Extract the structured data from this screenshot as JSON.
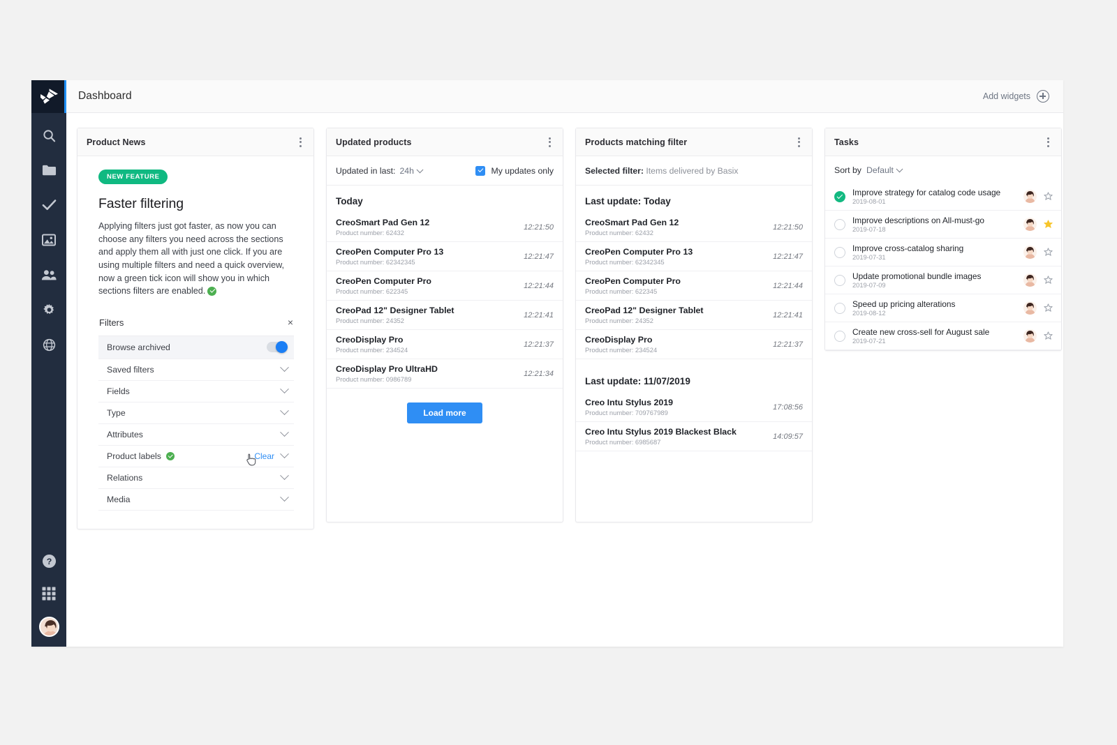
{
  "topbar": {
    "title": "Dashboard",
    "add_widgets_label": "Add widgets"
  },
  "sidebar": {
    "items": [
      {
        "icon": "search-icon",
        "name": "search"
      },
      {
        "icon": "folder-icon",
        "name": "catalog"
      },
      {
        "icon": "check-icon",
        "name": "tasks"
      },
      {
        "icon": "image-icon",
        "name": "media"
      },
      {
        "icon": "users-icon",
        "name": "users"
      },
      {
        "icon": "gear-icon",
        "name": "settings"
      },
      {
        "icon": "globe-icon",
        "name": "globe"
      }
    ],
    "bottom_items": [
      {
        "icon": "help-icon",
        "name": "help"
      },
      {
        "icon": "apps-grid-icon",
        "name": "apps"
      },
      {
        "icon": "avatar",
        "name": "profile"
      }
    ]
  },
  "product_news": {
    "title": "Product News",
    "badge": "NEW FEATURE",
    "headline": "Faster filtering",
    "body": "Applying filters just got faster, as now you can choose any filters you need across the sections and apply them all with just one click. If you are using multiple filters and need a quick overview, now a green tick icon will show you in which sections filters are enabled.",
    "filters_title": "Filters",
    "close_label": "×",
    "filters": [
      {
        "label": "Browse archived",
        "control": "toggle",
        "toggle_on": true,
        "highlight": true
      },
      {
        "label": "Saved filters",
        "control": "chevron"
      },
      {
        "label": "Fields",
        "control": "chevron"
      },
      {
        "label": "Type",
        "control": "chevron"
      },
      {
        "label": "Attributes",
        "control": "chevron"
      },
      {
        "label": "Product labels",
        "control": "chevron",
        "tick": true,
        "clear_label": "Clear"
      },
      {
        "label": "Relations",
        "control": "chevron"
      },
      {
        "label": "Media",
        "control": "chevron"
      }
    ]
  },
  "updated_products": {
    "title": "Updated products",
    "updated_in_last_label": "Updated in last:",
    "updated_in_last_value": "24h",
    "my_updates_only_label": "My updates only",
    "my_updates_only_checked": true,
    "group_label": "Today",
    "items": [
      {
        "name": "CreoSmart Pad Gen 12",
        "number": "Product number: 62432",
        "time": "12:21:50"
      },
      {
        "name": "CreoPen Computer Pro 13",
        "number": "Product number: 62342345",
        "time": "12:21:47"
      },
      {
        "name": "CreoPen Computer Pro",
        "number": "Product number: 622345",
        "time": "12:21:44"
      },
      {
        "name": "CreoPad 12\" Designer Tablet",
        "number": "Product number: 24352",
        "time": "12:21:41"
      },
      {
        "name": "CreoDisplay Pro",
        "number": "Product number: 234524",
        "time": "12:21:37"
      },
      {
        "name": "CreoDisplay Pro UltraHD",
        "number": "Product number: 0986789",
        "time": "12:21:34"
      }
    ],
    "load_more_label": "Load more"
  },
  "products_matching_filter": {
    "title": "Products matching filter",
    "selected_filter_label": "Selected filter:",
    "selected_filter_value": "Items delivered by Basix",
    "groups": [
      {
        "label": "Last update: Today",
        "items": [
          {
            "name": "CreoSmart Pad Gen 12",
            "number": "Product number: 62432",
            "time": "12:21:50"
          },
          {
            "name": "CreoPen Computer Pro 13",
            "number": "Product number: 62342345",
            "time": "12:21:47"
          },
          {
            "name": "CreoPen Computer Pro",
            "number": "Product number: 622345",
            "time": "12:21:44"
          },
          {
            "name": "CreoPad 12\" Designer Tablet",
            "number": "Product number: 24352",
            "time": "12:21:41"
          },
          {
            "name": "CreoDisplay Pro",
            "number": "Product number: 234524",
            "time": "12:21:37"
          }
        ]
      },
      {
        "label": "Last update: 11/07/2019",
        "items": [
          {
            "name": "Creo Intu Stylus 2019",
            "number": "Product number: 709767989",
            "time": "17:08:56"
          },
          {
            "name": "Creo Intu Stylus 2019 Blackest Black",
            "number": "Product number: 6985687",
            "time": "14:09:57"
          }
        ]
      }
    ]
  },
  "tasks": {
    "title": "Tasks",
    "sort_by_label": "Sort by",
    "sort_by_value": "Default",
    "items": [
      {
        "title": "Improve strategy for catalog code usage",
        "date": "2019-08-01",
        "done": true,
        "starred": false
      },
      {
        "title": "Improve descriptions on All-must-go",
        "date": "2019-07-18",
        "done": false,
        "starred": true
      },
      {
        "title": "Improve cross-catalog sharing",
        "date": "2019-07-31",
        "done": false,
        "starred": false
      },
      {
        "title": "Update promotional bundle images",
        "date": "2019-07-09",
        "done": false,
        "starred": false
      },
      {
        "title": "Speed up pricing alterations",
        "date": "2019-08-12",
        "done": false,
        "starred": false
      },
      {
        "title": "Create new cross-sell for August sale",
        "date": "2019-07-21",
        "done": false,
        "starred": false
      }
    ]
  },
  "colors": {
    "accent_blue": "#2f8ef4",
    "green": "#10b981",
    "sidebar": "#222d3f",
    "star_yellow": "#f7c52b"
  }
}
